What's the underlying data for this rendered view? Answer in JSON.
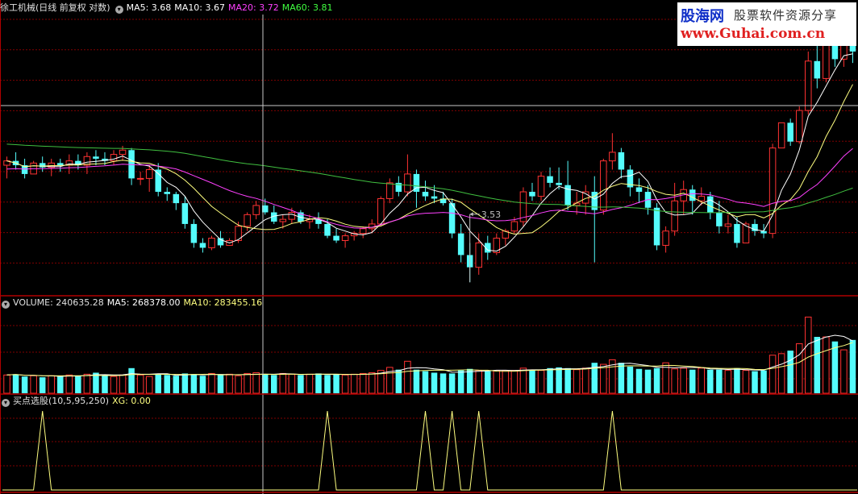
{
  "main": {
    "stock_label": "徐工机械(日线 前复权 对数)",
    "ma_items": [
      {
        "label": "MA5: 3.68",
        "color": "#ffffff"
      },
      {
        "label": "MA10: 3.67",
        "color": "#ffffff"
      },
      {
        "label": "MA20: 3.72",
        "color": "#ff40ff"
      },
      {
        "label": "MA60: 3.81",
        "color": "#40ff40"
      }
    ],
    "low_marker": "3.53"
  },
  "volume": {
    "label": "VOLUME: 240635.28",
    "ma5": "MA5: 268378.00",
    "ma10": "MA10: 283455.16"
  },
  "indicator": {
    "label": "买点选股(10,5,95,250)",
    "value": "XG: 0.00"
  },
  "watermark": {
    "line1_brand": "股海网",
    "line1_text": "股票软件资源分享",
    "line2": "www.Guhai.com.cn"
  },
  "colors": {
    "up": "#ff3232",
    "down": "#54fcfc",
    "ma5": "#ffffff",
    "ma10": "#ffff80",
    "ma20": "#ff40ff",
    "ma60": "#40c040",
    "xg": "#ffff80",
    "grid": "#800000"
  },
  "chart_data": [
    {
      "type": "candlestick",
      "name": "price",
      "ohlc": [
        [
          3.72,
          3.76,
          3.66,
          3.74
        ],
        [
          3.74,
          3.78,
          3.7,
          3.72
        ],
        [
          3.72,
          3.75,
          3.66,
          3.68
        ],
        [
          3.68,
          3.74,
          3.68,
          3.73
        ],
        [
          3.73,
          3.76,
          3.69,
          3.71
        ],
        [
          3.71,
          3.75,
          3.67,
          3.73
        ],
        [
          3.73,
          3.75,
          3.69,
          3.72
        ],
        [
          3.72,
          3.77,
          3.68,
          3.74
        ],
        [
          3.74,
          3.77,
          3.7,
          3.72
        ],
        [
          3.72,
          3.78,
          3.68,
          3.76
        ],
        [
          3.76,
          3.79,
          3.72,
          3.75
        ],
        [
          3.75,
          3.78,
          3.72,
          3.74
        ],
        [
          3.74,
          3.79,
          3.72,
          3.77
        ],
        [
          3.77,
          3.81,
          3.74,
          3.79
        ],
        [
          3.79,
          3.8,
          3.63,
          3.66
        ],
        [
          3.66,
          3.69,
          3.63,
          3.66
        ],
        [
          3.66,
          3.72,
          3.6,
          3.7
        ],
        [
          3.7,
          3.73,
          3.58,
          3.6
        ],
        [
          3.6,
          3.62,
          3.56,
          3.59
        ],
        [
          3.59,
          3.6,
          3.52,
          3.55
        ],
        [
          3.55,
          3.58,
          3.44,
          3.46
        ],
        [
          3.46,
          3.48,
          3.36,
          3.38
        ],
        [
          3.38,
          3.4,
          3.34,
          3.36
        ],
        [
          3.36,
          3.41,
          3.35,
          3.4
        ],
        [
          3.4,
          3.43,
          3.36,
          3.37
        ],
        [
          3.37,
          3.4,
          3.37,
          3.39
        ],
        [
          3.39,
          3.47,
          3.38,
          3.45
        ],
        [
          3.45,
          3.51,
          3.43,
          3.5
        ],
        [
          3.5,
          3.56,
          3.48,
          3.54
        ],
        [
          3.54,
          3.57,
          3.5,
          3.51
        ],
        [
          3.51,
          3.54,
          3.46,
          3.47
        ],
        [
          3.47,
          3.5,
          3.44,
          3.48
        ],
        [
          3.48,
          3.53,
          3.46,
          3.51
        ],
        [
          3.51,
          3.52,
          3.46,
          3.47
        ],
        [
          3.47,
          3.5,
          3.44,
          3.48
        ],
        [
          3.48,
          3.51,
          3.44,
          3.46
        ],
        [
          3.46,
          3.48,
          3.4,
          3.41
        ],
        [
          3.41,
          3.44,
          3.38,
          3.39
        ],
        [
          3.39,
          3.42,
          3.36,
          3.41
        ],
        [
          3.41,
          3.43,
          3.39,
          3.42
        ],
        [
          3.42,
          3.45,
          3.4,
          3.44
        ],
        [
          3.44,
          3.48,
          3.42,
          3.46
        ],
        [
          3.46,
          3.58,
          3.45,
          3.57
        ],
        [
          3.57,
          3.66,
          3.55,
          3.64
        ],
        [
          3.64,
          3.67,
          3.58,
          3.6
        ],
        [
          3.6,
          3.77,
          3.58,
          3.68
        ],
        [
          3.68,
          3.7,
          3.53,
          3.6
        ],
        [
          3.6,
          3.65,
          3.56,
          3.58
        ],
        [
          3.58,
          3.63,
          3.55,
          3.57
        ],
        [
          3.57,
          3.6,
          3.54,
          3.55
        ],
        [
          3.55,
          3.57,
          3.4,
          3.42
        ],
        [
          3.42,
          3.46,
          3.3,
          3.33
        ],
        [
          3.33,
          3.38,
          3.22,
          3.28
        ],
        [
          3.28,
          3.42,
          3.25,
          3.38
        ],
        [
          3.38,
          3.41,
          3.31,
          3.34
        ],
        [
          3.34,
          3.42,
          3.33,
          3.4
        ],
        [
          3.4,
          3.44,
          3.37,
          3.43
        ],
        [
          3.43,
          3.49,
          3.42,
          3.47
        ],
        [
          3.47,
          3.62,
          3.45,
          3.6
        ],
        [
          3.6,
          3.64,
          3.56,
          3.58
        ],
        [
          3.58,
          3.69,
          3.56,
          3.67
        ],
        [
          3.67,
          3.71,
          3.62,
          3.64
        ],
        [
          3.64,
          3.71,
          3.61,
          3.63
        ],
        [
          3.63,
          3.74,
          3.52,
          3.54
        ],
        [
          3.54,
          3.6,
          3.5,
          3.55
        ],
        [
          3.55,
          3.63,
          3.5,
          3.6
        ],
        [
          3.6,
          3.67,
          3.3,
          3.52
        ],
        [
          3.52,
          3.75,
          3.5,
          3.74
        ],
        [
          3.74,
          3.87,
          3.7,
          3.78
        ],
        [
          3.78,
          3.8,
          3.66,
          3.7
        ],
        [
          3.7,
          3.72,
          3.58,
          3.62
        ],
        [
          3.62,
          3.66,
          3.55,
          3.6
        ],
        [
          3.6,
          3.63,
          3.5,
          3.53
        ],
        [
          3.53,
          3.55,
          3.35,
          3.37
        ],
        [
          3.37,
          3.45,
          3.34,
          3.43
        ],
        [
          3.43,
          3.64,
          3.41,
          3.56
        ],
        [
          3.56,
          3.65,
          3.5,
          3.61
        ],
        [
          3.61,
          3.63,
          3.5,
          3.56
        ],
        [
          3.56,
          3.62,
          3.54,
          3.58
        ],
        [
          3.58,
          3.6,
          3.48,
          3.51
        ],
        [
          3.51,
          3.56,
          3.42,
          3.45
        ],
        [
          3.45,
          3.5,
          3.42,
          3.46
        ],
        [
          3.46,
          3.49,
          3.36,
          3.38
        ],
        [
          3.38,
          3.47,
          3.38,
          3.46
        ],
        [
          3.46,
          3.48,
          3.41,
          3.43
        ],
        [
          3.43,
          3.46,
          3.4,
          3.42
        ],
        [
          3.42,
          3.82,
          3.4,
          3.8
        ],
        [
          3.8,
          3.92,
          3.8,
          3.92
        ],
        [
          3.92,
          3.94,
          3.81,
          3.83
        ],
        [
          3.83,
          4.0,
          3.82,
          3.98
        ],
        [
          3.98,
          4.28,
          3.96,
          4.23
        ],
        [
          4.23,
          4.34,
          4.09,
          4.14
        ],
        [
          4.14,
          4.4,
          4.12,
          4.33
        ],
        [
          4.33,
          4.4,
          4.2,
          4.24
        ],
        [
          4.24,
          4.41,
          4.2,
          4.35
        ],
        [
          4.35,
          4.4,
          4.22,
          4.28
        ]
      ],
      "ma5": "computed from close",
      "ma10": "computed from close",
      "ma20": "computed from close",
      "ma60": "computed from close",
      "low_marker_value": 3.53,
      "ylim": [
        3.17,
        4.48
      ]
    },
    {
      "type": "bar",
      "name": "volume",
      "values": [
        240,
        250,
        220,
        230,
        210,
        230,
        220,
        240,
        230,
        250,
        270,
        230,
        220,
        240,
        330,
        240,
        220,
        250,
        240,
        230,
        260,
        250,
        230,
        260,
        240,
        250,
        230,
        260,
        270,
        250,
        240,
        260,
        250,
        240,
        250,
        260,
        240,
        250,
        240,
        250,
        260,
        270,
        300,
        340,
        310,
        420,
        310,
        290,
        270,
        260,
        260,
        300,
        320,
        300,
        290,
        300,
        300,
        300,
        330,
        310,
        300,
        330,
        340,
        330,
        310,
        330,
        400,
        380,
        440,
        400,
        350,
        320,
        310,
        330,
        400,
        320,
        330,
        310,
        330,
        310,
        310,
        300,
        330,
        300,
        290,
        300,
        500,
        520,
        560,
        650,
        1000,
        740,
        740,
        680,
        570,
        700
      ],
      "current_volume": 240635.28,
      "ma5": 268378.0,
      "ma10": 283455.16,
      "ylim": [
        0,
        1100
      ]
    },
    {
      "type": "line",
      "name": "XG",
      "signal_indices": [
        4,
        36,
        47,
        50,
        53,
        68
      ],
      "values_description": "0 except 1 at signal bars",
      "current": 0.0,
      "ylim": [
        0,
        1
      ]
    }
  ]
}
